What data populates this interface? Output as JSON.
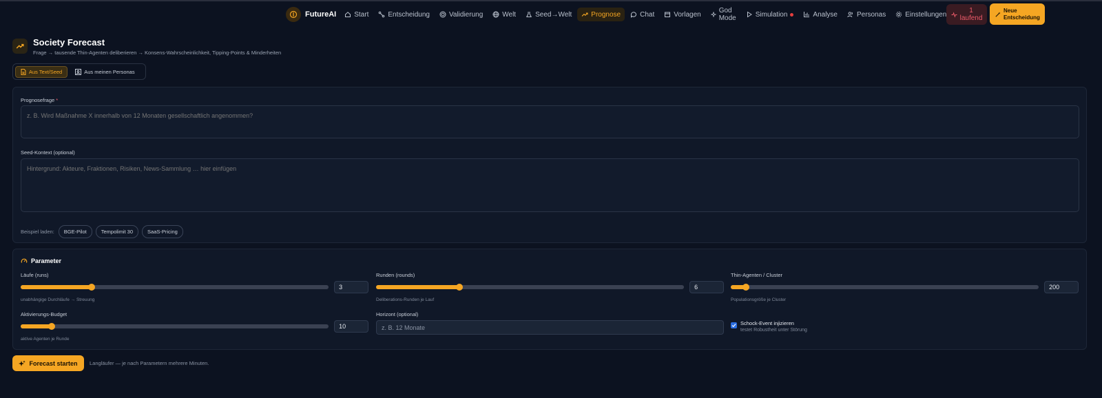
{
  "app": {
    "name": "FutureAI"
  },
  "nav": {
    "items": [
      {
        "label": "Start",
        "icon": "home-icon"
      },
      {
        "label": "Entscheidung",
        "icon": "route-icon"
      },
      {
        "label": "Validierung",
        "icon": "target-icon"
      },
      {
        "label": "Welt",
        "icon": "globe-icon"
      },
      {
        "label": "Seed→Welt",
        "icon": "flask-icon"
      },
      {
        "label": "Prognose",
        "icon": "trending-up-icon",
        "active": true
      },
      {
        "label": "Chat",
        "icon": "chat-icon"
      },
      {
        "label": "Vorlagen",
        "icon": "template-icon"
      },
      {
        "label_line1": "God",
        "label_line2": "Mode",
        "icon": "sparkle-icon"
      },
      {
        "label": "Simulation",
        "icon": "play-icon",
        "status_dot": "#e53e3e"
      },
      {
        "label": "Analyse",
        "icon": "bar-chart-icon"
      },
      {
        "label": "Personas",
        "icon": "users-icon"
      },
      {
        "label": "Einstellungen",
        "icon": "gear-icon"
      }
    ],
    "running": {
      "count": "1",
      "label": "laufend"
    },
    "new_decision": {
      "line1": "Neue",
      "line2": "Entscheidung"
    }
  },
  "header": {
    "title": "Society Forecast",
    "subtitle": "Frage → tausende Thin-Agenten deliberieren → Konsens-Wahrscheinlichkeit, Tipping-Points & Minderheiten"
  },
  "source_toggle": {
    "options": [
      {
        "label": "Aus Text/Seed",
        "active": true
      },
      {
        "label": "Aus meinen Personas",
        "active": false
      }
    ]
  },
  "form": {
    "question_label": "Prognosefrage",
    "question_required": "*",
    "question_placeholder": "z. B. Wird Maßnahme X innerhalb von 12 Monaten gesellschaftlich angenommen?",
    "seed_label": "Seed-Kontext (optional)",
    "seed_placeholder": "Hintergrund: Akteure, Fraktionen, Risiken, News-Sammlung … hier einfügen",
    "examples_label": "Beispiel laden:",
    "examples": [
      "BGE-Pilot",
      "Tempolimit 30",
      "SaaS-Pricing"
    ]
  },
  "params": {
    "title": "Parameter",
    "runs": {
      "label": "Läufe (runs)",
      "value": "3",
      "fraction": 0.23,
      "hint": "unabhängige Durchläufe → Streuung"
    },
    "rounds": {
      "label": "Runden (rounds)",
      "value": "6",
      "fraction": 0.27,
      "hint": "Deliberations-Runden je Lauf"
    },
    "agents": {
      "label": "Thin-Agenten / Cluster",
      "value": "200",
      "fraction": 0.05,
      "hint": "Populationsgröße je Cluster"
    },
    "budget": {
      "label": "Aktivierungs-Budget",
      "value": "10",
      "fraction": 0.1,
      "hint": "aktive Agenten je Runde"
    },
    "horizon": {
      "label": "Horizont (optional)",
      "placeholder": "z. B. 12 Monate"
    },
    "shock": {
      "label": "Schock-Event injizieren",
      "hint": "testet Robustheit unter Störung",
      "checked": true
    }
  },
  "actions": {
    "start_label": "Forecast starten",
    "start_hint": "Langläufer — je nach Parametern mehrere Minuten."
  },
  "colors": {
    "accent": "#f5a623",
    "background": "#0c1220",
    "danger": "#ef5b6a"
  }
}
